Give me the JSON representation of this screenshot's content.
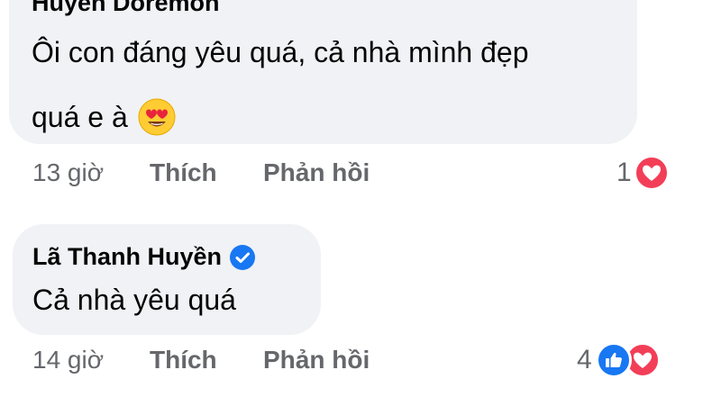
{
  "comments": [
    {
      "author": "Huyền Doremon",
      "text_line1": "Ôi con đáng yêu quá, cả nhà mình đẹp",
      "text_line2": "quá e à",
      "emoji": "heart-eyes-emoji",
      "time": "13 giờ",
      "like_label": "Thích",
      "reply_label": "Phản hồi",
      "reaction_count": "1",
      "reactions": [
        "love"
      ]
    },
    {
      "author": "Lã Thanh Huyền",
      "verified": true,
      "text_line1": "Cả nhà yêu quá",
      "time": "14 giờ",
      "like_label": "Thích",
      "reply_label": "Phản hồi",
      "reaction_count": "4",
      "reactions": [
        "like",
        "love"
      ]
    }
  ],
  "colors": {
    "bubble": "#f0f2f5",
    "meta_text": "#65676b",
    "like_blue": "#1877f2",
    "love_red": "#f33e58"
  }
}
